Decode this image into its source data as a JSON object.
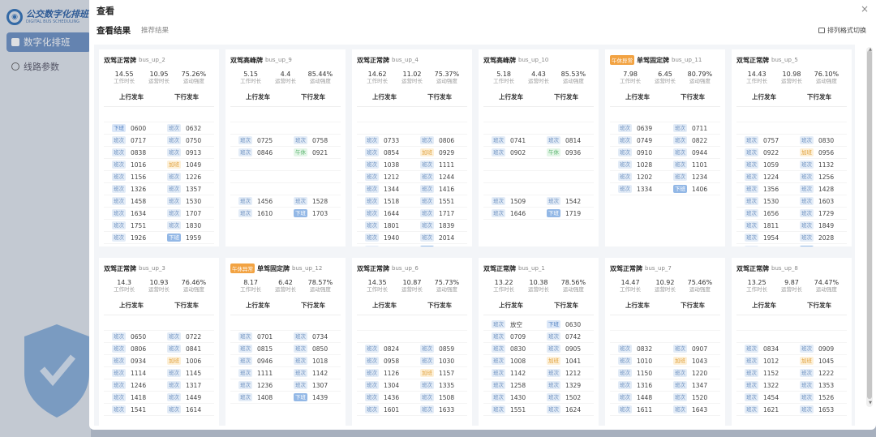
{
  "background_app": {
    "logo_title": "公交数字化排班",
    "logo_subtitle": "DIGITAL BUS SCHEDULING",
    "nav": [
      {
        "label": "数字化排班",
        "active": true
      },
      {
        "label": "线路参数",
        "active": false
      }
    ]
  },
  "modal": {
    "title": "查看",
    "close": "×",
    "tabs": {
      "active": "查看结果",
      "inactive": "推荐结果"
    },
    "layout_toggle": "排列格式切换"
  },
  "stat_labels": [
    "工作时长",
    "运营时长",
    "运动强度"
  ],
  "column_labels": [
    "上行发车",
    "下行发车"
  ],
  "colors": {
    "accent": "#6b8fc2",
    "special_tag": "#f2a343"
  },
  "cards": [
    {
      "type": "双驾正常牌",
      "code": "bus_up_2",
      "stats": [
        "14.55",
        "10.95",
        "75.26%"
      ],
      "rows": [
        [
          null,
          null
        ],
        [
          [
            "下班",
            "0600"
          ],
          [
            "班次",
            "0632"
          ]
        ],
        [
          [
            "班次",
            "0717"
          ],
          [
            "班次",
            "0750"
          ]
        ],
        [
          [
            "班次",
            "0838"
          ],
          [
            "班次",
            "0913"
          ]
        ],
        [
          [
            "班次",
            "1016"
          ],
          [
            "加班",
            "1049"
          ]
        ],
        [
          [
            "班次",
            "1156"
          ],
          [
            "班次",
            "1226"
          ]
        ],
        [
          [
            "班次",
            "1326"
          ],
          [
            "班次",
            "1357"
          ]
        ],
        [
          [
            "班次",
            "1458"
          ],
          [
            "班次",
            "1530"
          ]
        ],
        [
          [
            "班次",
            "1634"
          ],
          [
            "班次",
            "1707"
          ]
        ],
        [
          [
            "班次",
            "1751"
          ],
          [
            "班次",
            "1830"
          ]
        ],
        [
          [
            "班次",
            "1926"
          ],
          [
            "下班",
            "1959"
          ]
        ]
      ]
    },
    {
      "type": "双驾高峰牌",
      "code": "bus_up_9",
      "stats": [
        "5.15",
        "4.4",
        "85.44%"
      ],
      "rows": [
        [
          null,
          null
        ],
        [
          null,
          null
        ],
        [
          [
            "班次",
            "0725"
          ],
          [
            "班次",
            "0758"
          ]
        ],
        [
          [
            "班次",
            "0846"
          ],
          [
            "午休",
            "0921"
          ]
        ],
        [
          null,
          null
        ],
        [
          null,
          null
        ],
        [
          null,
          null
        ],
        [
          [
            "班次",
            "1456"
          ],
          [
            "班次",
            "1528"
          ]
        ],
        [
          [
            "班次",
            "1610"
          ],
          [
            "下班",
            "1703"
          ]
        ]
      ]
    },
    {
      "type": "双驾正常牌",
      "code": "bus_up_4",
      "stats": [
        "14.62",
        "11.02",
        "75.37%"
      ],
      "rows": [
        [
          null,
          null
        ],
        [
          null,
          null
        ],
        [
          [
            "班次",
            "0733"
          ],
          [
            "班次",
            "0806"
          ]
        ],
        [
          [
            "班次",
            "0854"
          ],
          [
            "加班",
            "0929"
          ]
        ],
        [
          [
            "班次",
            "1038"
          ],
          [
            "班次",
            "1111"
          ]
        ],
        [
          [
            "班次",
            "1212"
          ],
          [
            "班次",
            "1244"
          ]
        ],
        [
          [
            "班次",
            "1344"
          ],
          [
            "班次",
            "1416"
          ]
        ],
        [
          [
            "班次",
            "1518"
          ],
          [
            "班次",
            "1551"
          ]
        ],
        [
          [
            "班次",
            "1644"
          ],
          [
            "班次",
            "1717"
          ]
        ],
        [
          [
            "班次",
            "1801"
          ],
          [
            "班次",
            "1839"
          ]
        ],
        [
          [
            "班次",
            "1940"
          ],
          [
            "班次",
            "2014"
          ]
        ],
        [
          [
            "班次",
            "2107"
          ],
          [
            "下班",
            "2139"
          ]
        ]
      ]
    },
    {
      "type": "双驾高峰牌",
      "code": "bus_up_10",
      "stats": [
        "5.18",
        "4.43",
        "85.53%"
      ],
      "rows": [
        [
          null,
          null
        ],
        [
          null,
          null
        ],
        [
          [
            "班次",
            "0741"
          ],
          [
            "班次",
            "0814"
          ]
        ],
        [
          [
            "班次",
            "0902"
          ],
          [
            "午休",
            "0936"
          ]
        ],
        [
          null,
          null
        ],
        [
          null,
          null
        ],
        [
          null,
          null
        ],
        [
          [
            "班次",
            "1509"
          ],
          [
            "班次",
            "1542"
          ]
        ],
        [
          [
            "班次",
            "1646"
          ],
          [
            "下班",
            "1719"
          ]
        ]
      ]
    },
    {
      "type": "单驾固定牌",
      "special": "午休异常",
      "code": "bus_up_11",
      "stats": [
        "7.98",
        "6.45",
        "80.79%"
      ],
      "rows": [
        [
          null,
          null
        ],
        [
          [
            "班次",
            "0639"
          ],
          [
            "班次",
            "0711"
          ]
        ],
        [
          [
            "班次",
            "0749"
          ],
          [
            "班次",
            "0822"
          ]
        ],
        [
          [
            "班次",
            "0910"
          ],
          [
            "班次",
            "0944"
          ]
        ],
        [
          [
            "班次",
            "1028"
          ],
          [
            "班次",
            "1101"
          ]
        ],
        [
          [
            "班次",
            "1202"
          ],
          [
            "班次",
            "1234"
          ]
        ],
        [
          [
            "班次",
            "1334"
          ],
          [
            "下班",
            "1406"
          ]
        ]
      ]
    },
    {
      "type": "双驾正常牌",
      "code": "bus_up_5",
      "stats": [
        "14.43",
        "10.98",
        "76.10%"
      ],
      "rows": [
        [
          null,
          null
        ],
        [
          null,
          null
        ],
        [
          [
            "班次",
            "0757"
          ],
          [
            "班次",
            "0830"
          ]
        ],
        [
          [
            "班次",
            "0922"
          ],
          [
            "加班",
            "0956"
          ]
        ],
        [
          [
            "班次",
            "1059"
          ],
          [
            "班次",
            "1132"
          ]
        ],
        [
          [
            "班次",
            "1224"
          ],
          [
            "班次",
            "1256"
          ]
        ],
        [
          [
            "班次",
            "1356"
          ],
          [
            "班次",
            "1428"
          ]
        ],
        [
          [
            "班次",
            "1530"
          ],
          [
            "班次",
            "1603"
          ]
        ],
        [
          [
            "班次",
            "1656"
          ],
          [
            "班次",
            "1729"
          ]
        ],
        [
          [
            "班次",
            "1811"
          ],
          [
            "班次",
            "1849"
          ]
        ],
        [
          [
            "班次",
            "1954"
          ],
          [
            "班次",
            "2028"
          ]
        ],
        [
          [
            "班次",
            "2120"
          ],
          [
            "下班",
            "2152"
          ]
        ]
      ]
    },
    {
      "type": "双驾正常牌",
      "code": "bus_up_3",
      "stats": [
        "14.3",
        "10.93",
        "76.46%"
      ],
      "rows": [
        [
          null,
          null
        ],
        [
          [
            "班次",
            "0650"
          ],
          [
            "班次",
            "0722"
          ]
        ],
        [
          [
            "班次",
            "0806"
          ],
          [
            "班次",
            "0841"
          ]
        ],
        [
          [
            "班次",
            "0934"
          ],
          [
            "加班",
            "1006"
          ]
        ],
        [
          [
            "班次",
            "1114"
          ],
          [
            "班次",
            "1145"
          ]
        ],
        [
          [
            "班次",
            "1246"
          ],
          [
            "班次",
            "1317"
          ]
        ],
        [
          [
            "班次",
            "1418"
          ],
          [
            "班次",
            "1449"
          ]
        ],
        [
          [
            "班次",
            "1541"
          ],
          [
            "班次",
            "1614"
          ]
        ]
      ]
    },
    {
      "type": "单驾固定牌",
      "special": "午休异常",
      "code": "bus_up_12",
      "stats": [
        "8.17",
        "6.42",
        "78.57%"
      ],
      "rows": [
        [
          null,
          null
        ],
        [
          [
            "班次",
            "0701"
          ],
          [
            "班次",
            "0734"
          ]
        ],
        [
          [
            "班次",
            "0815"
          ],
          [
            "班次",
            "0850"
          ]
        ],
        [
          [
            "班次",
            "0946"
          ],
          [
            "班次",
            "1018"
          ]
        ],
        [
          [
            "班次",
            "1111"
          ],
          [
            "班次",
            "1142"
          ]
        ],
        [
          [
            "班次",
            "1236"
          ],
          [
            "班次",
            "1307"
          ]
        ],
        [
          [
            "班次",
            "1408"
          ],
          [
            "下班",
            "1439"
          ]
        ]
      ]
    },
    {
      "type": "双驾正常牌",
      "code": "bus_up_6",
      "stats": [
        "14.35",
        "10.87",
        "75.73%"
      ],
      "rows": [
        [
          null,
          null
        ],
        [
          null,
          null
        ],
        [
          [
            "班次",
            "0824"
          ],
          [
            "班次",
            "0859"
          ]
        ],
        [
          [
            "班次",
            "0958"
          ],
          [
            "班次",
            "1030"
          ]
        ],
        [
          [
            "班次",
            "1126"
          ],
          [
            "加班",
            "1157"
          ]
        ],
        [
          [
            "班次",
            "1304"
          ],
          [
            "班次",
            "1335"
          ]
        ],
        [
          [
            "班次",
            "1436"
          ],
          [
            "班次",
            "1508"
          ]
        ],
        [
          [
            "班次",
            "1601"
          ],
          [
            "班次",
            "1633"
          ]
        ]
      ]
    },
    {
      "type": "双驾正常牌",
      "code": "bus_up_1",
      "stats": [
        "13.22",
        "10.38",
        "78.56%"
      ],
      "rows": [
        [
          [
            "班次",
            "放空"
          ],
          [
            "下班",
            "0630"
          ]
        ],
        [
          [
            "班次",
            "0709"
          ],
          [
            "班次",
            "0742"
          ]
        ],
        [
          [
            "班次",
            "0830"
          ],
          [
            "班次",
            "0905"
          ]
        ],
        [
          [
            "班次",
            "1008"
          ],
          [
            "加班",
            "1041"
          ]
        ],
        [
          [
            "班次",
            "1142"
          ],
          [
            "班次",
            "1212"
          ]
        ],
        [
          [
            "班次",
            "1258"
          ],
          [
            "班次",
            "1329"
          ]
        ],
        [
          [
            "班次",
            "1430"
          ],
          [
            "班次",
            "1502"
          ]
        ],
        [
          [
            "班次",
            "1551"
          ],
          [
            "班次",
            "1624"
          ]
        ]
      ]
    },
    {
      "type": "双驾正常牌",
      "code": "bus_up_7",
      "stats": [
        "14.47",
        "10.92",
        "75.46%"
      ],
      "rows": [
        [
          null,
          null
        ],
        [
          null,
          null
        ],
        [
          [
            "班次",
            "0832"
          ],
          [
            "班次",
            "0907"
          ]
        ],
        [
          [
            "班次",
            "1010"
          ],
          [
            "加班",
            "1043"
          ]
        ],
        [
          [
            "班次",
            "1150"
          ],
          [
            "班次",
            "1220"
          ]
        ],
        [
          [
            "班次",
            "1316"
          ],
          [
            "班次",
            "1347"
          ]
        ],
        [
          [
            "班次",
            "1448"
          ],
          [
            "班次",
            "1520"
          ]
        ],
        [
          [
            "班次",
            "1611"
          ],
          [
            "班次",
            "1643"
          ]
        ]
      ]
    },
    {
      "type": "双驾正常牌",
      "code": "bus_up_8",
      "stats": [
        "13.25",
        "9.87",
        "74.47%"
      ],
      "rows": [
        [
          null,
          null
        ],
        [
          null,
          null
        ],
        [
          [
            "班次",
            "0834"
          ],
          [
            "班次",
            "0909"
          ]
        ],
        [
          [
            "班次",
            "1012"
          ],
          [
            "加班",
            "1045"
          ]
        ],
        [
          [
            "班次",
            "1152"
          ],
          [
            "班次",
            "1222"
          ]
        ],
        [
          [
            "班次",
            "1322"
          ],
          [
            "班次",
            "1353"
          ]
        ],
        [
          [
            "班次",
            "1454"
          ],
          [
            "班次",
            "1526"
          ]
        ],
        [
          [
            "班次",
            "1621"
          ],
          [
            "班次",
            "1653"
          ]
        ]
      ]
    }
  ]
}
